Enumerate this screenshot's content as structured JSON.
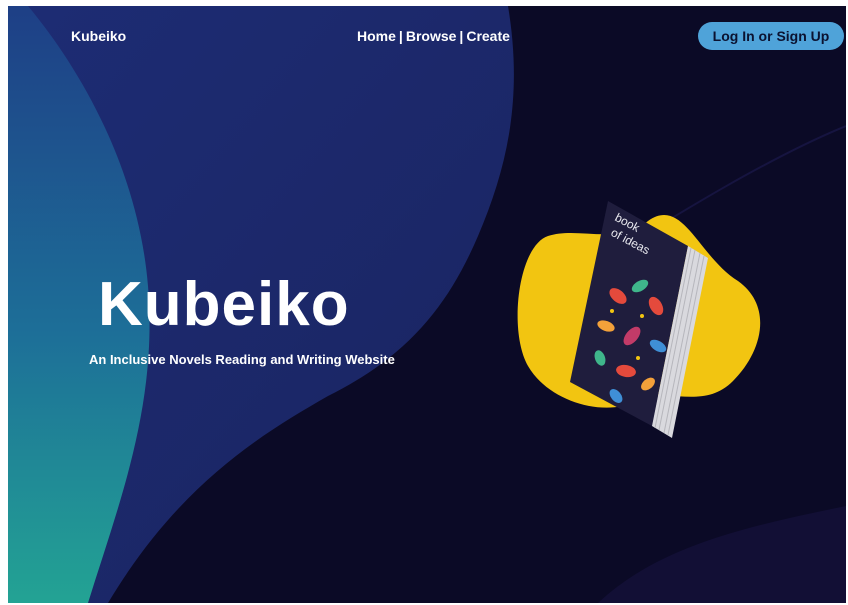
{
  "nav": {
    "brand": "Kubeiko",
    "links": [
      "Home",
      "Browse",
      "Create"
    ],
    "separator": "|",
    "login_label": "Log In or Sign Up"
  },
  "hero": {
    "title": "Kubeiko",
    "subtitle": "An Inclusive Novels Reading and Writing Website"
  },
  "book": {
    "cover_title_line1": "book",
    "cover_title_line2": "of ideas"
  },
  "colors": {
    "background": "#0b0a26",
    "wave_blue": "#1f2f7a",
    "wave_teal": "#1e9a95",
    "blob_yellow": "#f2c511",
    "button": "#4fa3d9"
  }
}
